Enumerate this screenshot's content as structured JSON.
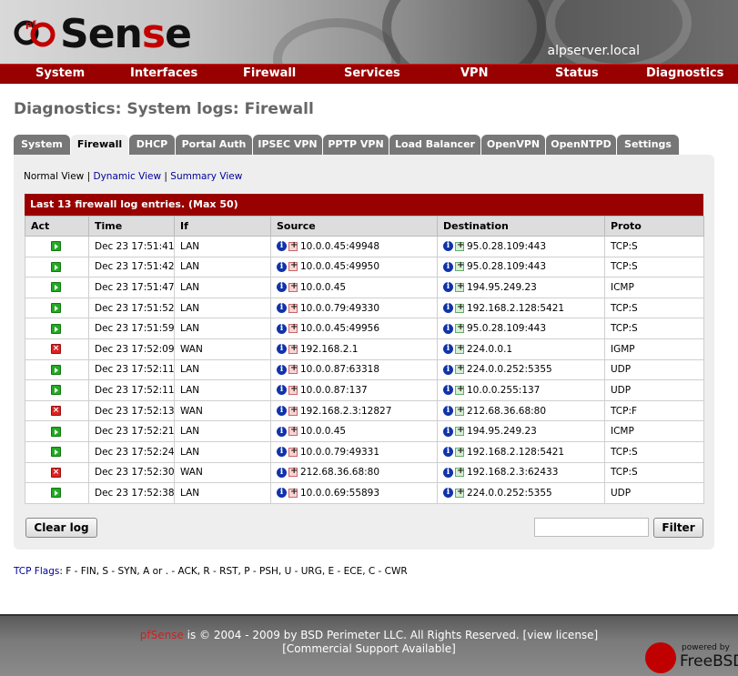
{
  "header": {
    "logo_text_prefix": "S",
    "logo_text_mid": "en",
    "logo_text_red": "s",
    "logo_text_end": "e",
    "logo_pf": "pf",
    "hostname": "alpserver.local"
  },
  "nav": [
    "System",
    "Interfaces",
    "Firewall",
    "Services",
    "VPN",
    "Status",
    "Diagnostics"
  ],
  "page_title": "Diagnostics: System logs: Firewall",
  "tabs": [
    "System",
    "Firewall",
    "DHCP",
    "Portal Auth",
    "IPSEC VPN",
    "PPTP VPN",
    "Load Balancer",
    "OpenVPN",
    "OpenNTPD",
    "Settings"
  ],
  "active_tab": "Firewall",
  "views": {
    "normal": "Normal View",
    "sep1": "|",
    "dynamic": "Dynamic View",
    "sep2": "|",
    "summary": "Summary View"
  },
  "log": {
    "caption": "Last 13 firewall log entries. (Max 50)",
    "columns": [
      "Act",
      "Time",
      "If",
      "Source",
      "Destination",
      "Proto"
    ],
    "rows": [
      {
        "act": "pass",
        "time": "Dec 23 17:51:41",
        "if": "LAN",
        "source": "10.0.0.45:49948",
        "destination": "95.0.28.109:443",
        "proto": "TCP:S"
      },
      {
        "act": "pass",
        "time": "Dec 23 17:51:42",
        "if": "LAN",
        "source": "10.0.0.45:49950",
        "destination": "95.0.28.109:443",
        "proto": "TCP:S"
      },
      {
        "act": "pass",
        "time": "Dec 23 17:51:47",
        "if": "LAN",
        "source": "10.0.0.45",
        "destination": "194.95.249.23",
        "proto": "ICMP"
      },
      {
        "act": "pass",
        "time": "Dec 23 17:51:52",
        "if": "LAN",
        "source": "10.0.0.79:49330",
        "destination": "192.168.2.128:5421",
        "proto": "TCP:S"
      },
      {
        "act": "pass",
        "time": "Dec 23 17:51:59",
        "if": "LAN",
        "source": "10.0.0.45:49956",
        "destination": "95.0.28.109:443",
        "proto": "TCP:S"
      },
      {
        "act": "block",
        "time": "Dec 23 17:52:09",
        "if": "WAN",
        "source": "192.168.2.1",
        "destination": "224.0.0.1",
        "proto": "IGMP"
      },
      {
        "act": "pass",
        "time": "Dec 23 17:52:11",
        "if": "LAN",
        "source": "10.0.0.87:63318",
        "destination": "224.0.0.252:5355",
        "proto": "UDP"
      },
      {
        "act": "pass",
        "time": "Dec 23 17:52:11",
        "if": "LAN",
        "source": "10.0.0.87:137",
        "destination": "10.0.0.255:137",
        "proto": "UDP"
      },
      {
        "act": "block",
        "time": "Dec 23 17:52:13",
        "if": "WAN",
        "source": "192.168.2.3:12827",
        "destination": "212.68.36.68:80",
        "proto": "TCP:F"
      },
      {
        "act": "pass",
        "time": "Dec 23 17:52:21",
        "if": "LAN",
        "source": "10.0.0.45",
        "destination": "194.95.249.23",
        "proto": "ICMP"
      },
      {
        "act": "pass",
        "time": "Dec 23 17:52:24",
        "if": "LAN",
        "source": "10.0.0.79:49331",
        "destination": "192.168.2.128:5421",
        "proto": "TCP:S"
      },
      {
        "act": "block",
        "time": "Dec 23 17:52:30",
        "if": "WAN",
        "source": "212.68.36.68:80",
        "destination": "192.168.2.3:62433",
        "proto": "TCP:S"
      },
      {
        "act": "pass",
        "time": "Dec 23 17:52:38",
        "if": "LAN",
        "source": "10.0.0.69:55893",
        "destination": "224.0.0.252:5355",
        "proto": "UDP"
      }
    ]
  },
  "buttons": {
    "clear": "Clear log",
    "filter": "Filter",
    "filter_value": ""
  },
  "tcp_flags": {
    "label": "TCP Flags",
    "text": ": F - FIN, S - SYN, A or . - ACK, R - RST, P - PSH, U - URG, E - ECE, C - CWR"
  },
  "footer": {
    "brand": "pfSense",
    "line1_rest": " is © 2004 - 2009 by BSD Perimeter LLC. All Rights Reserved. [view license]",
    "line2": "[Commercial Support Available]",
    "powered_by": "powered by",
    "freebsd": "FreeBSD"
  },
  "colors": {
    "nav_red": "#990000",
    "tab_gray": "#777777",
    "panel_bg": "#eeeeee",
    "link_blue": "#000099"
  }
}
